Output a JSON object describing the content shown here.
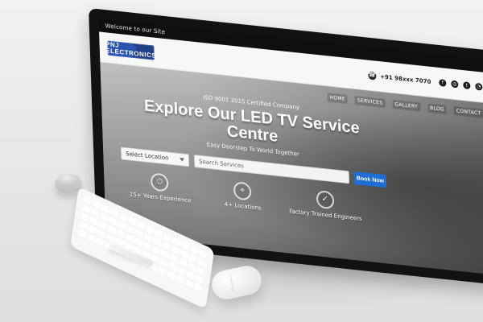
{
  "topbar": {
    "welcome_text": "Welcome to our Site"
  },
  "header": {
    "logo_text": "PNJ ELECTRONICS",
    "phone": "+91 98xxx 7070",
    "icons": {
      "phone_icon": "phone-icon",
      "facebook_icon": "facebook-icon",
      "instagram_icon": "instagram-icon",
      "twitter_icon": "twitter-icon",
      "whatsapp_icon": "whatsapp-icon"
    }
  },
  "nav": {
    "items": [
      "Home",
      "Services",
      "Gallery",
      "Blog",
      "Contact"
    ]
  },
  "hero": {
    "kicker": "ISO 9001 2015 Certified Company",
    "headline": "Explore Our LED TV Service Centre",
    "subhead": "Easy Doorstep To World Together",
    "search": {
      "dropdown_value": "Select Location",
      "input_placeholder": "Search Services",
      "button_label": "Book Now"
    },
    "features": [
      {
        "icon": "clock-icon",
        "title": "15+ Years Experience"
      },
      {
        "icon": "location-icon",
        "title": "4+ Locations"
      },
      {
        "icon": "check-icon",
        "title": "Factory Trained Engineers"
      }
    ]
  }
}
